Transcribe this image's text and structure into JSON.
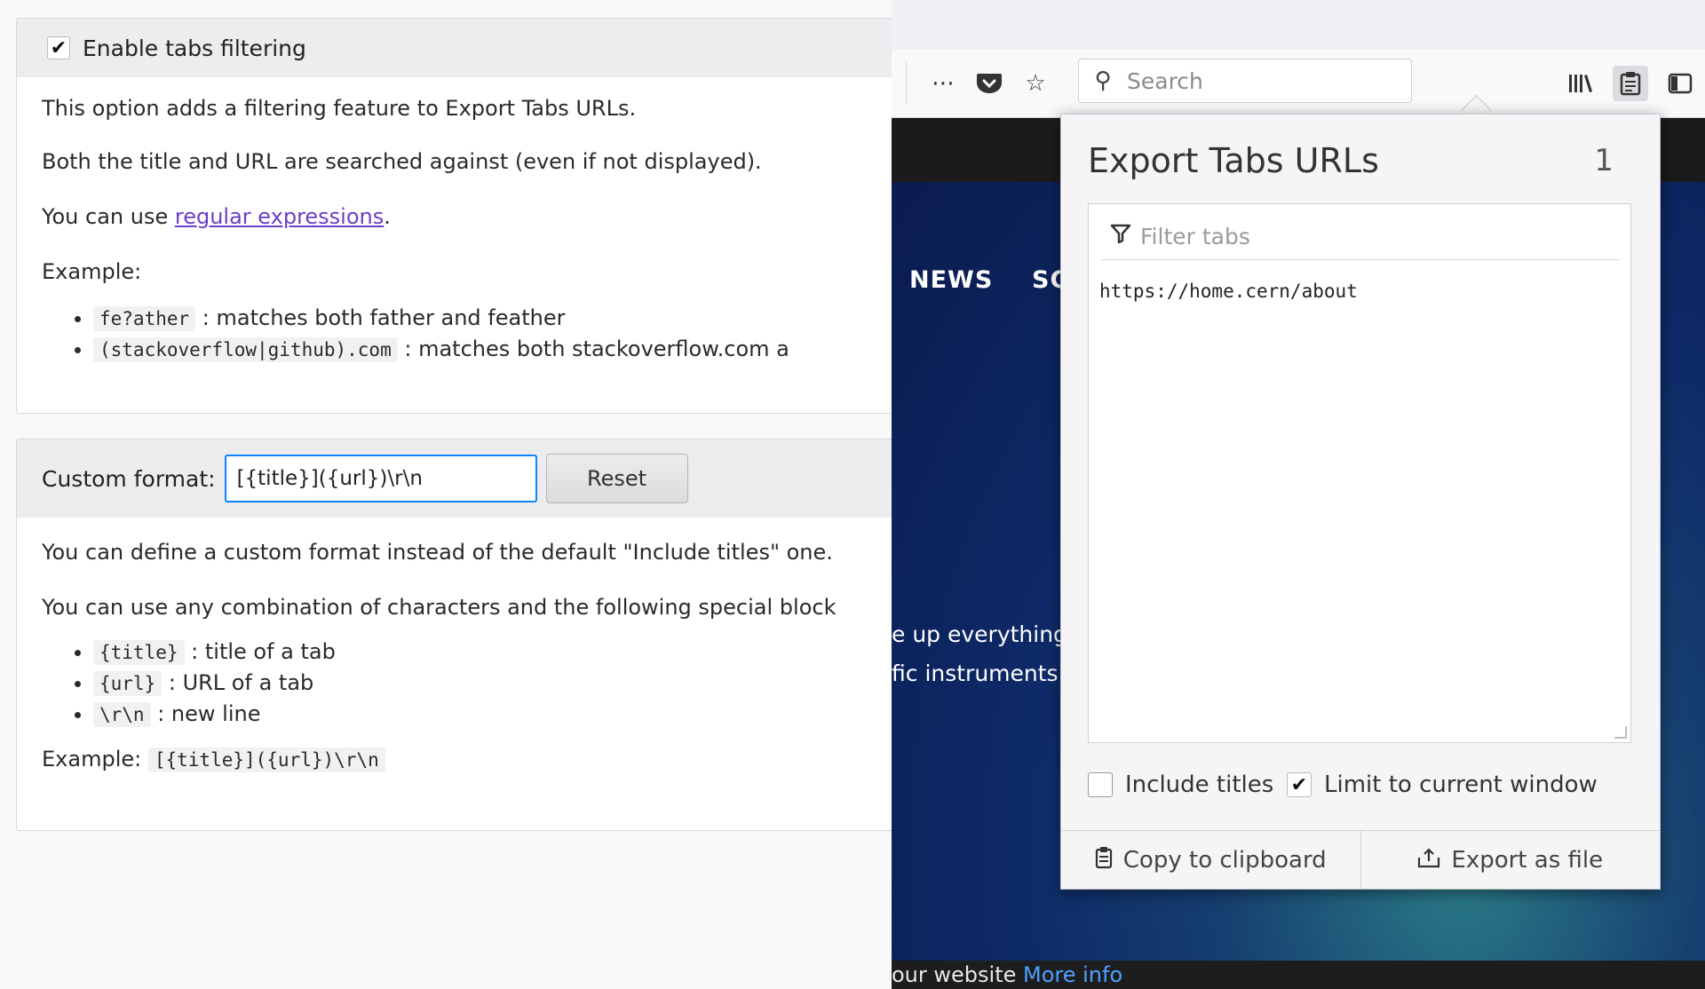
{
  "options": {
    "filter_panel": {
      "checkbox_checked": true,
      "header": "Enable tabs filtering",
      "line1": "This option adds a filtering feature to Export Tabs URLs.",
      "line2": "Both the title and URL are searched against (even if not displayed).",
      "line3_prefix": "You can use ",
      "line3_link": "regular expressions",
      "line3_suffix": ".",
      "example_label": "Example:",
      "examples": [
        {
          "code": "fe?ather",
          "text": " : matches both father and feather"
        },
        {
          "code": "(stackoverflow|github).com",
          "text": " : matches both stackoverflow.com a"
        }
      ]
    },
    "format_panel": {
      "label": "Custom format:",
      "input_value": "[{title}]({url})\\r\\n",
      "reset_label": "Reset",
      "line1": "You can define a custom format instead of the default \"Include titles\" one.",
      "line2": "You can use any combination of characters and the following special block",
      "blocks": [
        {
          "code": "{title}",
          "text": " : title of a tab"
        },
        {
          "code": "{url}",
          "text": " : URL of a tab"
        },
        {
          "code": "\\r\\n",
          "text": " : new line"
        }
      ],
      "example_label": "Example:",
      "example_code": "[{title}]({url})\\r\\n"
    }
  },
  "browser": {
    "toolbar": {
      "icons": [
        "more-icon",
        "pocket-icon",
        "bookmark-star-icon",
        "library-icon",
        "export-tabs-icon",
        "sidebar-icon"
      ],
      "search_placeholder": "Search"
    },
    "site": {
      "nav": [
        "NEWS",
        "SC"
      ],
      "text1": "e up everything",
      "text2": "fic instruments",
      "footer_text": "our website ",
      "footer_link": "More info"
    },
    "popup": {
      "title": "Export Tabs URLs",
      "count": "1",
      "filter_placeholder": "Filter tabs",
      "urls": [
        "https://home.cern/about"
      ],
      "include_titles_label": "Include titles",
      "include_titles_checked": false,
      "limit_label": "Limit to current window",
      "limit_checked": true,
      "copy_label": "Copy to clipboard",
      "export_label": "Export as file"
    }
  }
}
